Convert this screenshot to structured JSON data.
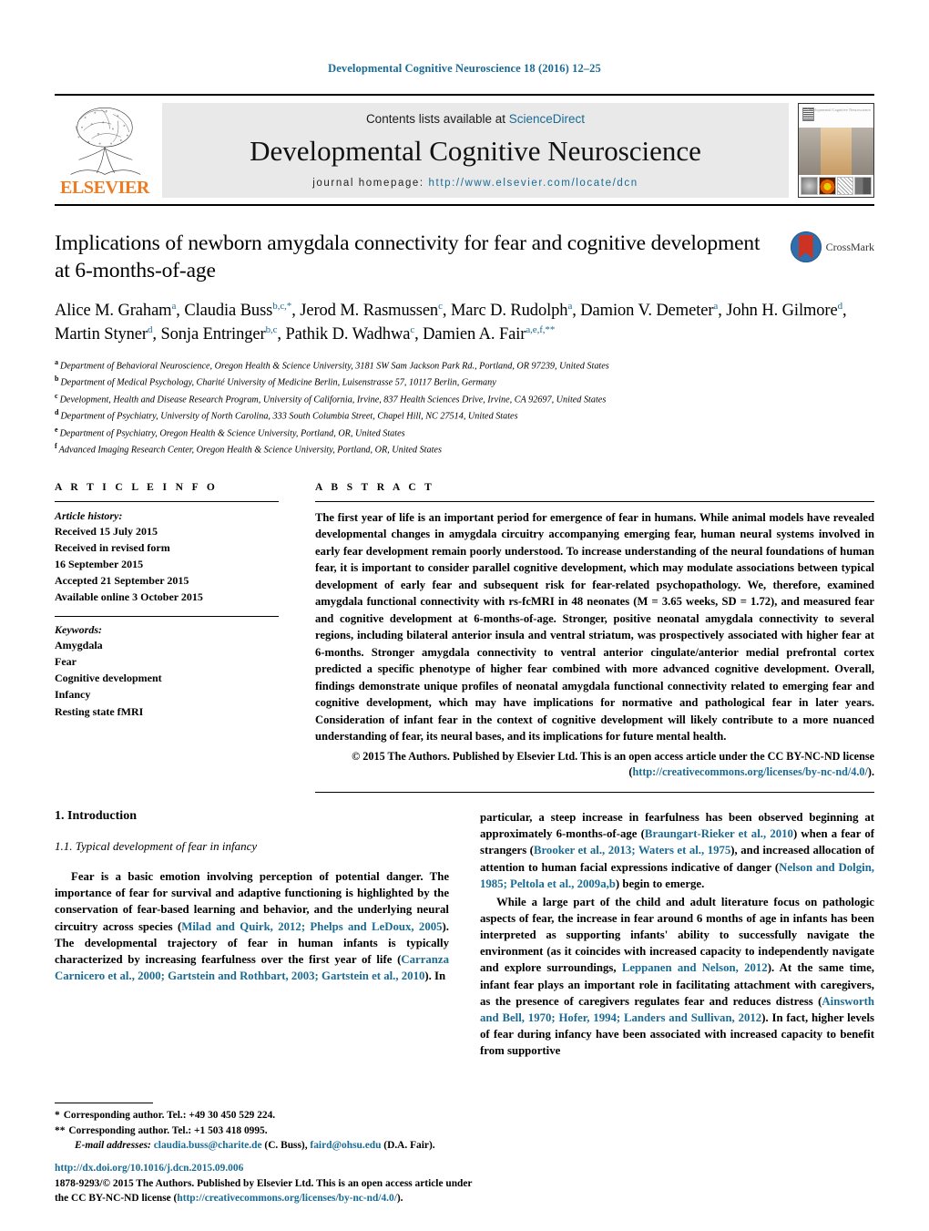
{
  "running_head": "Developmental Cognitive Neuroscience 18 (2016) 12–25",
  "masthead": {
    "contents_prefix": "Contents lists available at ",
    "sciencedirect": "ScienceDirect",
    "journal_title": "Developmental Cognitive Neuroscience",
    "homepage_prefix": "journal homepage: ",
    "homepage_url": "http://www.elsevier.com/locate/dcn",
    "publisher": "ELSEVIER",
    "cover_caption": "Developmental Cognitive Neuroscience"
  },
  "crossmark": {
    "label": "CrossMark"
  },
  "article": {
    "title": "Implications of newborn amygdala connectivity for fear and cognitive development at 6-months-of-age",
    "authors_html": "Alice M. Graham<sup>a</sup>, Claudia Buss<sup>b,c,<span class=\"ast\">*</span></sup>, Jerod M. Rasmussen<sup>c</sup>, Marc D. Rudolph<sup>a</sup>, Damion V. Demeter<sup>a</sup>, John H. Gilmore<sup>d</sup>, Martin Styner<sup>d</sup>, Sonja Entringer<sup>b,c</sup>, Pathik D. Wadhwa<sup>c</sup>, Damien A. Fair<sup>a,e,f,**</sup>",
    "affiliations": [
      {
        "mark": "a",
        "text": "Department of Behavioral Neuroscience, Oregon Health & Science University, 3181 SW Sam Jackson Park Rd., Portland, OR 97239, United States"
      },
      {
        "mark": "b",
        "text": "Department of Medical Psychology, Charité University of Medicine Berlin, Luisenstrasse 57, 10117 Berlin, Germany"
      },
      {
        "mark": "c",
        "text": "Development, Health and Disease Research Program, University of California, Irvine, 837 Health Sciences Drive, Irvine, CA 92697, United States"
      },
      {
        "mark": "d",
        "text": "Department of Psychiatry, University of North Carolina, 333 South Columbia Street, Chapel Hill, NC 27514, United States"
      },
      {
        "mark": "e",
        "text": "Department of Psychiatry, Oregon Health & Science University, Portland, OR, United States"
      },
      {
        "mark": "f",
        "text": "Advanced Imaging Research Center, Oregon Health & Science University, Portland, OR, United States"
      }
    ]
  },
  "article_info": {
    "label": "A R T I C L E    I N F O",
    "history_head": "Article history:",
    "history": [
      "Received 15 July 2015",
      "Received in revised form",
      "16 September 2015",
      "Accepted 21 September 2015",
      "Available online 3 October 2015"
    ],
    "keywords_head": "Keywords:",
    "keywords": [
      "Amygdala",
      "Fear",
      "Cognitive development",
      "Infancy",
      "Resting state fMRI"
    ]
  },
  "abstract": {
    "label": "A B S T R A C T",
    "text": "The first year of life is an important period for emergence of fear in humans. While animal models have revealed developmental changes in amygdala circuitry accompanying emerging fear, human neural systems involved in early fear development remain poorly understood. To increase understanding of the neural foundations of human fear, it is important to consider parallel cognitive development, which may modulate associations between typical development of early fear and subsequent risk for fear-related psychopathology. We, therefore, examined amygdala functional connectivity with rs-fcMRI in 48 neonates (M = 3.65 weeks, SD = 1.72), and measured fear and cognitive development at 6-months-of-age. Stronger, positive neonatal amygdala connectivity to several regions, including bilateral anterior insula and ventral striatum, was prospectively associated with higher fear at 6-months. Stronger amygdala connectivity to ventral anterior cingulate/anterior medial prefrontal cortex predicted a specific phenotype of higher fear combined with more advanced cognitive development. Overall, findings demonstrate unique profiles of neonatal amygdala functional connectivity related to emerging fear and cognitive development, which may have implications for normative and pathological fear in later years. Consideration of infant fear in the context of cognitive development will likely contribute to a more nuanced understanding of fear, its neural bases, and its implications for future mental health.",
    "copyright_text": "© 2015 The Authors. Published by Elsevier Ltd. This is an open access article under the CC BY-NC-ND license (",
    "copyright_url": "http://creativecommons.org/licenses/by-nc-nd/4.0/",
    "copyright_tail": ")."
  },
  "body": {
    "section_number_title": "1.  Introduction",
    "subsection_title": "1.1.  Typical development of fear in infancy",
    "left_paragraph_html": "Fear is a basic emotion involving perception of potential danger. The importance of fear for survival and adaptive functioning is highlighted by the conservation of fear-based learning and behavior, and the underlying neural circuitry across species (<span class=\"cite\">Milad and Quirk, 2012; Phelps and LeDoux, 2005</span>). The developmental trajectory of fear in human infants is typically characterized by increasing fearfulness over the first year of life (<span class=\"cite\">Carranza Carnicero et al., 2000; Gartstein and Rothbart, 2003; Gartstein et al., 2010</span>). In",
    "right_paragraph_1_html": "particular, a steep increase in fearfulness has been observed beginning at approximately 6-months-of-age (<span class=\"cite\">Braungart-Rieker et al., 2010</span>) when a fear of strangers (<span class=\"cite\">Brooker et al., 2013; Waters et al., 1975</span>), and increased allocation of attention to human facial expressions indicative of danger (<span class=\"cite\">Nelson and Dolgin, 1985; Peltola et al., 2009a,b</span>) begin to emerge.",
    "right_paragraph_2_html": "While a large part of the child and adult literature focus on pathologic aspects of fear, the increase in fear around 6 months of age in infants has been interpreted as supporting infants' ability to successfully navigate the environment (as it coincides with increased capacity to independently navigate and explore surroundings, <span class=\"cite\">Leppanen and Nelson, 2012</span>). At the same time, infant fear plays an important role in facilitating attachment with caregivers, as the presence of caregivers regulates fear and reduces distress (<span class=\"cite\">Ainsworth and Bell, 1970; Hofer, 1994; Landers and Sullivan, 2012</span>). In fact, higher levels of fear during infancy have been associated with increased capacity to benefit from supportive"
  },
  "footnotes": {
    "corr1_mark": "*",
    "corr1": "Corresponding author. Tel.: +49 30 450 529 224.",
    "corr2_mark": "**",
    "corr2": "Corresponding author. Tel.: +1 503 418 0995.",
    "email_label": "E-mail addresses:",
    "email1": "claudia.buss@charite.de",
    "email1_owner": "(C. Buss),",
    "email2": "faird@ohsu.edu",
    "email2_owner": "(D.A. Fair)."
  },
  "footer": {
    "doi": "http://dx.doi.org/10.1016/j.dcn.2015.09.006",
    "issn_line": "1878-9293/© 2015 The Authors. Published by Elsevier Ltd. This is an open access article under the CC BY-NC-ND license (",
    "license_url": "http://creativecommons.org/licenses/by-nc-nd/4.0/",
    "license_tail": ")."
  },
  "colors": {
    "link": "#1a6b94",
    "elsevier_orange": "#ED7C22",
    "masthead_bg": "#e9e9e9"
  }
}
